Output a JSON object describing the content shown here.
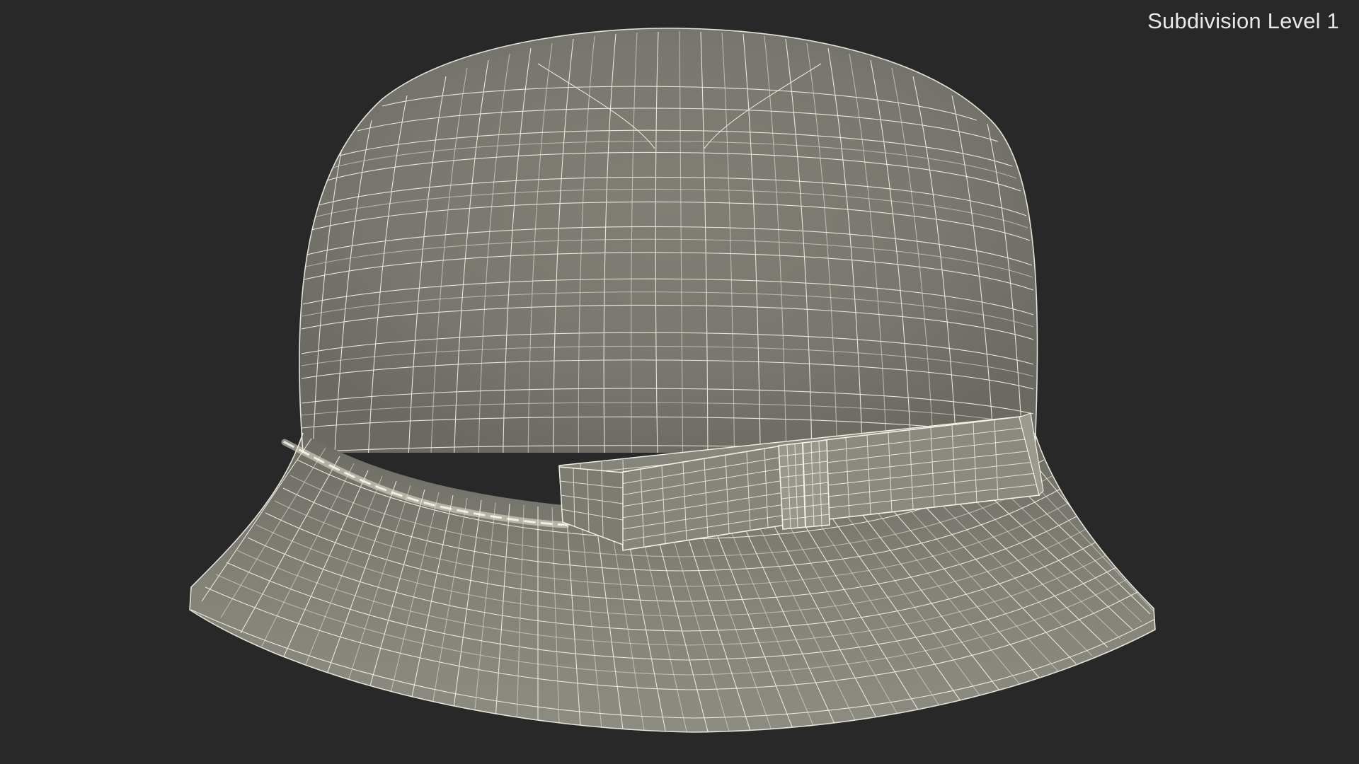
{
  "viewport": {
    "overlay_label": "Subdivision Level 1",
    "background_color": "#282828",
    "model_color": "#8a8a80",
    "wire_color": "#f4f2e6"
  },
  "model": {
    "subject": "cloche hat with ribbon bow",
    "render_mode": "wireframe-over-shaded"
  }
}
